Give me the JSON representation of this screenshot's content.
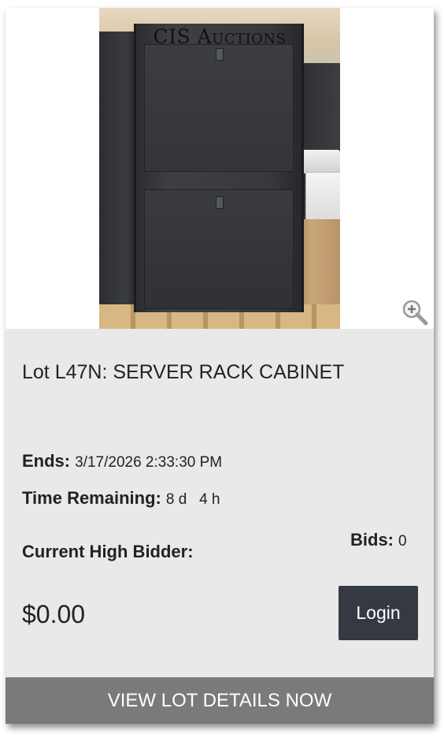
{
  "lot": {
    "title": "Lot L47N: SERVER RACK CABINET",
    "watermark": "CIS Auctions",
    "ends_label": "Ends:",
    "ends_value": "3/17/2026 2:33:30 PM",
    "time_remaining_label": "Time Remaining:",
    "time_remaining_value": "8 d   4 h",
    "high_bidder_label": "Current High Bidder:",
    "bids_label": "Bids:",
    "bids_value": "0",
    "price": "$0.00",
    "login_label": "Login",
    "details_label": "VIEW LOT DETAILS NOW"
  },
  "icons": {
    "zoom": "zoom-in-icon"
  },
  "colors": {
    "info_bg": "#e9e9e9",
    "login_bg": "#353a42",
    "details_bg": "#7a7a7a"
  }
}
